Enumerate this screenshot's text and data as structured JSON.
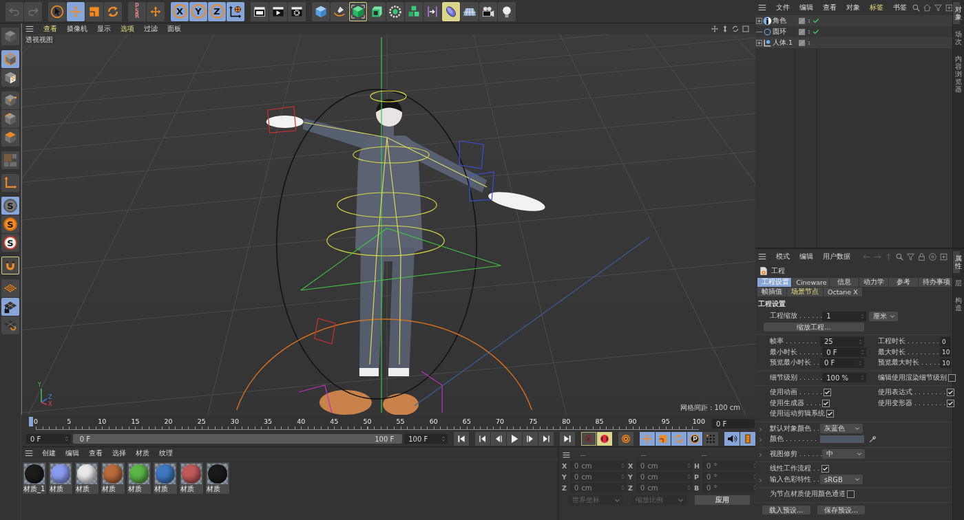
{
  "toolbar": {
    "groups": [
      {
        "items": [
          {
            "kind": "undo",
            "selected": false,
            "disabled": true,
            "outlined": false,
            "lit": false
          },
          {
            "kind": "redo",
            "selected": false,
            "disabled": true,
            "outlined": false,
            "lit": false
          }
        ]
      },
      {
        "items": [
          {
            "kind": "select",
            "selected": false,
            "disabled": false,
            "outlined": false,
            "lit": false
          },
          {
            "kind": "move",
            "selected": true,
            "disabled": false,
            "outlined": false,
            "lit": false
          },
          {
            "kind": "scale",
            "selected": false,
            "disabled": false,
            "outlined": false,
            "lit": false
          },
          {
            "kind": "rotate",
            "selected": false,
            "disabled": false,
            "outlined": false,
            "lit": false
          }
        ]
      },
      {
        "items": [
          {
            "kind": "psr",
            "label": "PSR",
            "selected": false,
            "disabled": true,
            "outlined": false,
            "lit": false
          },
          {
            "kind": "transform",
            "selected": false,
            "disabled": false,
            "outlined": false,
            "lit": false
          }
        ]
      },
      {
        "items": [
          {
            "kind": "axis",
            "label": "X",
            "selected": true,
            "disabled": false,
            "outlined": false,
            "lit": false
          },
          {
            "kind": "axis",
            "label": "Y",
            "selected": true,
            "disabled": false,
            "outlined": false,
            "lit": false
          },
          {
            "kind": "axis",
            "label": "Z",
            "selected": true,
            "disabled": false,
            "outlined": false,
            "lit": false
          },
          {
            "kind": "world",
            "selected": true,
            "disabled": false,
            "outlined": false,
            "lit": false
          }
        ]
      },
      {
        "items": [
          {
            "kind": "render-view",
            "selected": false,
            "disabled": false,
            "outlined": false,
            "lit": false
          },
          {
            "kind": "render",
            "selected": false,
            "disabled": false,
            "outlined": false,
            "lit": false
          },
          {
            "kind": "render-settings",
            "selected": false,
            "disabled": false,
            "outlined": false,
            "lit": false
          }
        ]
      },
      {
        "items": [
          {
            "kind": "cube",
            "selected": false,
            "disabled": false,
            "outlined": false,
            "lit": false
          },
          {
            "kind": "pen",
            "selected": false,
            "disabled": false,
            "outlined": false,
            "lit": false
          },
          {
            "kind": "cube-select",
            "selected": false,
            "disabled": false,
            "outlined": true,
            "lit": false
          },
          {
            "kind": "cube-generator",
            "selected": false,
            "disabled": false,
            "outlined": false,
            "lit": false
          },
          {
            "kind": "gear-cube",
            "selected": false,
            "disabled": false,
            "outlined": false,
            "lit": false
          },
          {
            "kind": "cubes",
            "selected": false,
            "disabled": false,
            "outlined": false,
            "lit": false
          },
          {
            "kind": "deformer",
            "selected": false,
            "disabled": false,
            "outlined": false,
            "lit": false
          },
          {
            "kind": "lens",
            "selected": false,
            "disabled": false,
            "outlined": false,
            "lit": true
          },
          {
            "kind": "floor",
            "selected": false,
            "disabled": false,
            "outlined": false,
            "lit": false
          },
          {
            "kind": "camera",
            "selected": false,
            "disabled": false,
            "outlined": false,
            "lit": false
          },
          {
            "kind": "light",
            "selected": false,
            "disabled": false,
            "outlined": false,
            "lit": false
          }
        ]
      }
    ]
  },
  "left_toolbar": {
    "groups": [
      {
        "items": [
          {
            "kind": "objects-mode",
            "selected": false,
            "disabled": false,
            "outlined": false,
            "lit": false
          }
        ]
      },
      {
        "items": [
          {
            "kind": "model",
            "selected": true,
            "disabled": false,
            "outlined": false,
            "lit": false
          },
          {
            "kind": "texture",
            "selected": false,
            "disabled": false,
            "outlined": false,
            "lit": false
          }
        ]
      },
      {
        "items": [
          {
            "kind": "point",
            "selected": false,
            "disabled": false,
            "outlined": false,
            "lit": false
          },
          {
            "kind": "edge",
            "selected": false,
            "disabled": false,
            "outlined": false,
            "lit": false
          },
          {
            "kind": "polygon",
            "selected": false,
            "disabled": false,
            "outlined": false,
            "lit": false
          }
        ]
      },
      {
        "items": [
          {
            "kind": "uv",
            "selected": false,
            "disabled": true,
            "outlined": false,
            "lit": false
          }
        ]
      },
      {
        "items": [
          {
            "kind": "axis-mode",
            "selected": false,
            "disabled": false,
            "outlined": false,
            "lit": false
          }
        ]
      },
      {
        "items": [
          {
            "kind": "snap",
            "label": "S",
            "selected": true,
            "disabled": false,
            "outlined": false,
            "lit": false
          },
          {
            "kind": "snap-orange",
            "label": "S",
            "selected": false,
            "disabled": false,
            "outlined": false,
            "lit": false
          },
          {
            "kind": "snap-ring",
            "label": "S",
            "selected": false,
            "disabled": false,
            "outlined": false,
            "lit": false
          }
        ]
      },
      {
        "items": [
          {
            "kind": "magnet",
            "selected": false,
            "disabled": false,
            "outlined": true,
            "lit": false
          }
        ]
      },
      {
        "items": [
          {
            "kind": "workplane",
            "selected": false,
            "disabled": false,
            "outlined": false,
            "lit": false
          },
          {
            "kind": "grid-lock",
            "selected": true,
            "disabled": false,
            "outlined": false,
            "lit": false
          },
          {
            "kind": "grid-cycle",
            "selected": false,
            "disabled": false,
            "outlined": false,
            "lit": false
          }
        ]
      }
    ]
  },
  "viewport": {
    "menu": [
      {
        "label": "查看",
        "highlighted": true
      },
      {
        "label": "摄像机",
        "highlighted": false
      },
      {
        "label": "显示",
        "highlighted": false
      },
      {
        "label": "选项",
        "highlighted": true
      },
      {
        "label": "过滤",
        "highlighted": false
      },
      {
        "label": "面板",
        "highlighted": false
      }
    ],
    "view_name": "透视视图",
    "grid_spacing": "网格间距 : 100 cm",
    "axes": [
      "Y",
      "Z",
      "X"
    ]
  },
  "timeline": {
    "ticks": [
      "0",
      "5",
      "10",
      "15",
      "20",
      "25",
      "30",
      "35",
      "40",
      "45",
      "50",
      "55",
      "60",
      "65",
      "70",
      "75",
      "80",
      "85",
      "90",
      "95",
      "100"
    ],
    "level": 0,
    "current_frame": "0 F"
  },
  "transport": {
    "start_field": "0 F",
    "range_start": "0 F",
    "range_end": "100 F",
    "end_field": "100 F",
    "buttons": [
      {
        "kind": "go-start",
        "selected": false
      },
      {
        "kind": "prev-key",
        "selected": false
      },
      {
        "kind": "prev-frame",
        "selected": false
      },
      {
        "kind": "play",
        "selected": false
      },
      {
        "kind": "next-frame",
        "selected": false
      },
      {
        "kind": "next-key",
        "selected": false
      },
      {
        "kind": "go-end",
        "selected": false
      },
      {
        "kind": "record",
        "selected": false
      },
      {
        "kind": "auto-key",
        "selected": false
      },
      {
        "kind": "key-settings",
        "selected": false
      },
      {
        "kind": "key-move",
        "selected": true
      },
      {
        "kind": "key-scale",
        "selected": true
      },
      {
        "kind": "key-rotate",
        "selected": true
      },
      {
        "kind": "key-param",
        "selected": true
      },
      {
        "kind": "key-points",
        "selected": false
      },
      {
        "kind": "sound",
        "selected": true
      },
      {
        "kind": "film",
        "selected": true
      }
    ]
  },
  "materials": {
    "menu": [
      "创建",
      "编辑",
      "查看",
      "选择",
      "材质",
      "纹理"
    ],
    "items": [
      {
        "name": "材质_1",
        "color": "#1c1c1c"
      },
      {
        "name": "材质",
        "color": "#8a9cf0"
      },
      {
        "name": "材质",
        "color": "#e8e8e8"
      },
      {
        "name": "材质",
        "color": "#b86a3a"
      },
      {
        "name": "材质",
        "color": "#5cb545"
      },
      {
        "name": "材质",
        "color": "#3f78c0"
      },
      {
        "name": "材质",
        "color": "#c05a5a"
      },
      {
        "name": "材质",
        "color": "#1a1a1a"
      }
    ]
  },
  "coordinates": {
    "headers": [
      "--",
      "--",
      "--"
    ],
    "rows": [
      {
        "cells": [
          {
            "axis": "X",
            "value": "0",
            "unit": "cm"
          },
          {
            "axis": "X",
            "value": "0",
            "unit": "cm"
          },
          {
            "axis": "H",
            "value": "0",
            "unit": "°"
          }
        ]
      },
      {
        "cells": [
          {
            "axis": "Y",
            "value": "0",
            "unit": "cm"
          },
          {
            "axis": "Y",
            "value": "0",
            "unit": "cm"
          },
          {
            "axis": "P",
            "value": "0",
            "unit": "°"
          }
        ]
      },
      {
        "cells": [
          {
            "axis": "Z",
            "value": "0",
            "unit": "cm"
          },
          {
            "axis": "Z",
            "value": "0",
            "unit": "cm"
          },
          {
            "axis": "B",
            "value": "0",
            "unit": "°"
          }
        ]
      }
    ],
    "dropdowns": [
      {
        "value": "世界坐标",
        "disabled": true
      },
      {
        "value": "缩放比例",
        "disabled": true
      }
    ],
    "apply": "应用"
  },
  "objects": {
    "menu": [
      {
        "label": "文件",
        "highlighted": false
      },
      {
        "label": "编辑",
        "highlighted": false
      },
      {
        "label": "查看",
        "highlighted": false
      },
      {
        "label": "对象",
        "highlighted": false
      },
      {
        "label": "标签",
        "highlighted": true
      },
      {
        "label": "书签",
        "highlighted": false
      }
    ],
    "tree": [
      {
        "name": "角色",
        "kind": "character",
        "expander": true,
        "enabled": true
      },
      {
        "name": "圆环",
        "kind": "circle",
        "expander": false,
        "enabled": true
      },
      {
        "name": "人体.1",
        "kind": "joint",
        "expander": true,
        "enabled": false
      }
    ],
    "side_tabs": [
      {
        "label": "对象",
        "selected": true
      },
      {
        "label": "场次",
        "selected": false
      },
      {
        "label": "内容浏览器",
        "selected": false
      }
    ]
  },
  "attributes": {
    "menu": [
      "模式",
      "编辑",
      "用户数据"
    ],
    "title": "工程",
    "tab_rows": [
      [
        {
          "label": "工程设置",
          "selected": true,
          "highlighted": false
        },
        {
          "label": "Cineware",
          "selected": false,
          "highlighted": false
        },
        {
          "label": "信息",
          "selected": false,
          "highlighted": false
        },
        {
          "label": "动力学",
          "selected": false,
          "highlighted": false
        },
        {
          "label": "参考",
          "selected": false,
          "highlighted": false
        },
        {
          "label": "待办事项",
          "selected": false,
          "highlighted": false
        }
      ],
      [
        {
          "label": "帧插值",
          "selected": false,
          "highlighted": false
        },
        {
          "label": "场景节点",
          "selected": false,
          "highlighted": true
        },
        {
          "label": "Octane X",
          "selected": false,
          "highlighted": false
        }
      ]
    ],
    "section": "工程设置",
    "groups": [
      [
        {
          "kind": "number_unit",
          "label": "工程缩放 . . . . . .",
          "value": "1",
          "unit": "厘米"
        },
        {
          "kind": "button",
          "label": "缩放工程..."
        }
      ],
      [
        {
          "kind": "pair",
          "left": {
            "kind": "field",
            "label": "帧率 . . . . . . . .",
            "value": "25"
          },
          "right": {
            "kind": "field",
            "label": "工程时长 . . . . . . . .",
            "value": "0"
          }
        },
        {
          "kind": "pair",
          "left": {
            "kind": "field",
            "label": "最小时长 . . . . . .",
            "value": "0 F"
          },
          "right": {
            "kind": "field",
            "label": "最大时长 . . . . . . . .",
            "value": "10"
          }
        },
        {
          "kind": "pair",
          "left": {
            "kind": "field",
            "label": "预览最小时长 . .",
            "value": "0 F"
          },
          "right": {
            "kind": "field",
            "label": "预览最大时长 . . . . .",
            "value": "10"
          }
        }
      ],
      [
        {
          "kind": "pair",
          "left": {
            "kind": "field",
            "label": "细节级别 . . . . . .",
            "value": "100 %"
          },
          "right": {
            "kind": "check",
            "label": "编辑使用渲染细节级别",
            "checked": false
          }
        }
      ],
      [
        {
          "kind": "pair",
          "left": {
            "kind": "check",
            "label": "使用动画 . . . . . .",
            "checked": true
          },
          "right": {
            "kind": "check",
            "label": "使用表达式 . . . . . . . .",
            "checked": true
          }
        },
        {
          "kind": "pair",
          "left": {
            "kind": "check",
            "label": "使用生成器 . . . .",
            "checked": true
          },
          "right": {
            "kind": "check",
            "label": "使用变形器 . . . . . . . .",
            "checked": true
          }
        },
        {
          "kind": "check",
          "label": "使用运动剪辑系统",
          "checked": true
        }
      ],
      [
        {
          "kind": "dropdown",
          "label": "默认对象颜色 . .",
          "value": "灰蓝色",
          "expanded": false
        },
        {
          "kind": "color",
          "label": "颜色 . . . . . . . .",
          "color": "#4e5866",
          "expanded": false
        }
      ],
      [
        {
          "kind": "dropdown",
          "label": "视图修剪 . . . . . .",
          "value": "中",
          "expanded": false
        }
      ],
      [
        {
          "kind": "check",
          "label": "线性工作流程 . .",
          "checked": true
        },
        {
          "kind": "dropdown",
          "label": "输入色彩特性 . .",
          "value": "sRGB",
          "expanded": false
        }
      ],
      [
        {
          "kind": "check",
          "label": "为节点材质使用颜色通道",
          "checked": false
        }
      ]
    ],
    "buttons": [
      "载入预设...",
      "保存预设..."
    ],
    "side_tabs": [
      {
        "label": "属性",
        "selected": true
      },
      {
        "label": "层",
        "selected": false
      },
      {
        "label": "构造",
        "selected": false
      }
    ]
  }
}
